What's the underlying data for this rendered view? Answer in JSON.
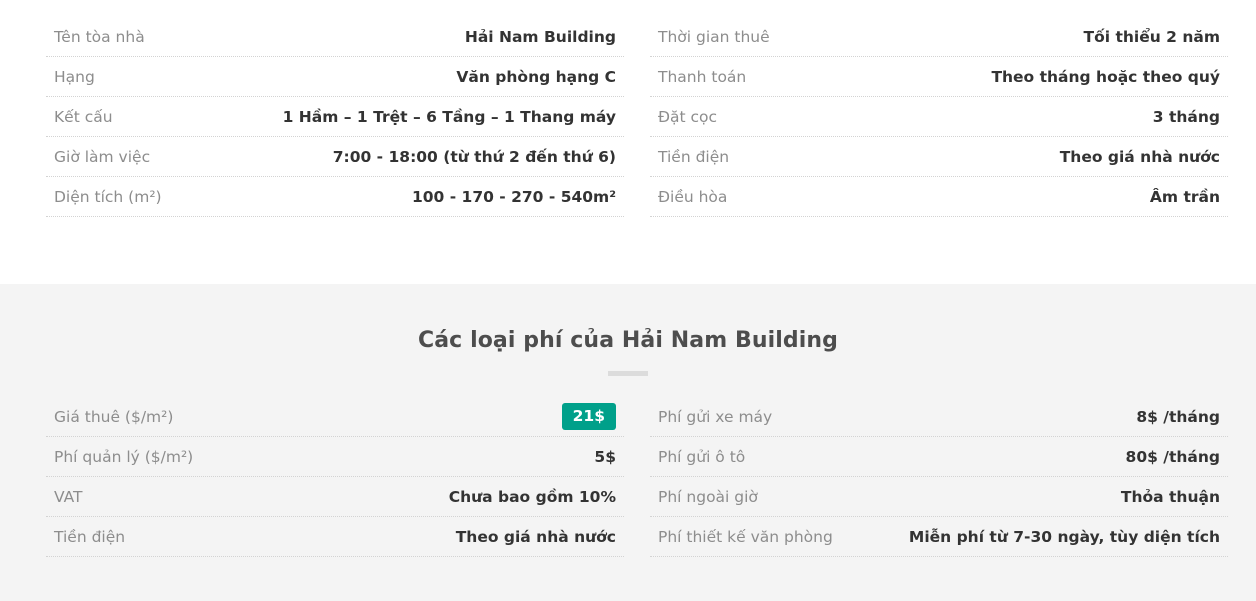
{
  "building": {
    "name": "Hải Nam Building"
  },
  "info_section": {
    "left_rows": [
      {
        "label": "Tên tòa nhà",
        "value": "Hải Nam Building"
      },
      {
        "label": "Hạng",
        "value": "Văn phòng hạng C"
      },
      {
        "label": "Kết cấu",
        "value": "1 Hầm – 1 Trệt – 6 Tầng – 1 Thang máy"
      },
      {
        "label": "Giờ làm việc",
        "value": "7:00 - 18:00 (từ thứ 2 đến thứ 6)"
      },
      {
        "label": "Diện tích (m²)",
        "value": "100 - 170 - 270 - 540m²"
      }
    ],
    "right_rows": [
      {
        "label": "Thời gian thuê",
        "value": "Tối thiểu 2 năm"
      },
      {
        "label": "Thanh toán",
        "value": "Theo tháng hoặc theo quý"
      },
      {
        "label": "Đặt cọc",
        "value": "3 tháng"
      },
      {
        "label": "Tiền điện",
        "value": "Theo giá nhà nước"
      },
      {
        "label": "Điều hòa",
        "value": "Âm trần"
      }
    ]
  },
  "fees_section": {
    "heading": "Các loại phí của Hải Nam Building",
    "left_rows": [
      {
        "label": "Giá thuê ($/m²)",
        "value": "21$",
        "badge": true
      },
      {
        "label": "Phí quản lý ($/m²)",
        "value": "5$",
        "badge": false
      },
      {
        "label": "VAT",
        "value": "Chưa bao gồm 10%",
        "badge": false
      },
      {
        "label": "Tiền điện",
        "value": "Theo giá nhà nước",
        "badge": false
      }
    ],
    "right_rows": [
      {
        "label": "Phí gửi xe máy",
        "value": "8$ /tháng",
        "badge": false
      },
      {
        "label": "Phí gửi ô tô",
        "value": "80$ /tháng",
        "badge": false
      },
      {
        "label": "Phí ngoài giờ",
        "value": "Thỏa thuận",
        "badge": false
      },
      {
        "label": "Phí thiết kế văn phòng",
        "value": "Miễn phí từ 7-30 ngày, tùy diện tích",
        "badge": false
      }
    ]
  },
  "colors": {
    "badge_background": "#00a08a",
    "section_background": "#f4f4f4",
    "label_text": "#8d8d8d",
    "value_text": "#333333",
    "divider": "#dcdcdc"
  }
}
